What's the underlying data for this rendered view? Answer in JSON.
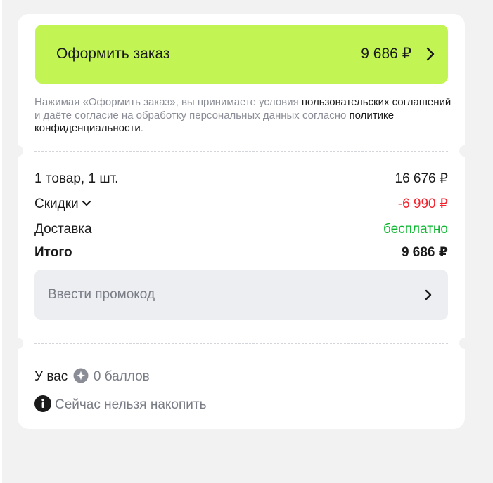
{
  "checkout": {
    "button_label": "Оформить заказ",
    "price": "9 686 ₽",
    "chevron_icon": "chevron-right-icon"
  },
  "terms": {
    "part1": "Нажимая «Оформить заказ», вы принимаете условия ",
    "link_agreements": "пользовательских соглашений",
    "part2": " и даёте согласие на обработку персональных данных согласно ",
    "link_privacy": "политике конфиденциальности",
    "part3": "."
  },
  "summary": {
    "items_label": "1 товар, 1 шт.",
    "items_value": "16 676 ₽",
    "discount_label": "Скидки",
    "discount_value": "-6 990 ₽",
    "delivery_label": "Доставка",
    "delivery_value": "бесплатно",
    "total_label": "Итого",
    "total_value": "9 686 ₽"
  },
  "promo": {
    "placeholder": "Ввести промокод"
  },
  "loyalty": {
    "prefix": "У вас",
    "points": "0 баллов",
    "accrue_text": "Сейчас нельзя накопить"
  },
  "colors": {
    "accent_button": "#c2f553",
    "discount_red": "#f5222d",
    "free_green": "#0ab82d",
    "muted_text": "#7a7d86",
    "background": "#f2f2f3"
  }
}
